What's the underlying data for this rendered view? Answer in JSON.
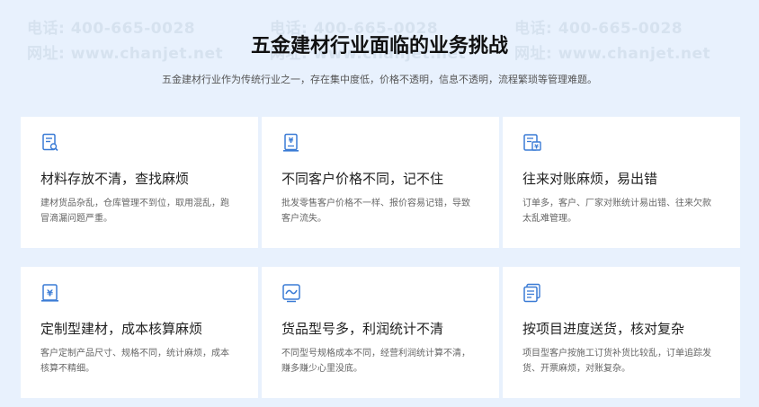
{
  "watermark": {
    "phone": "电话: 400-665-0028",
    "site": "网址: www.chanjet.net"
  },
  "section": {
    "title": "五金建材行业面临的业务挑战",
    "subtitle": "五金建材行业作为传统行业之一，存在集中度低，价格不透明，信息不透明，流程繁琐等管理难题。"
  },
  "cards": [
    {
      "icon": "document-search-icon",
      "title": "材料存放不清，查找麻烦",
      "desc": "建材货品杂乱，仓库管理不到位，取用混乱，跑冒滴漏问题严重。"
    },
    {
      "icon": "price-document-icon",
      "title": "不同客户价格不同，记不住",
      "desc": "批发零售客户价格不一样、报价容易记错，导致客户流失。"
    },
    {
      "icon": "reconciliation-icon",
      "title": "往来对账麻烦，易出错",
      "desc": "订单多，客户、厂家对账统计易出错、往来欠款太乱难管理。"
    },
    {
      "icon": "custom-price-icon",
      "title": "定制型建材，成本核算麻烦",
      "desc": "客户定制产品尺寸、规格不同，统计麻烦，成本核算不精细。"
    },
    {
      "icon": "profit-chart-icon",
      "title": "货品型号多，利润统计不清",
      "desc": "不同型号规格成本不同，经营利润统计算不清，赚多赚少心里没底。"
    },
    {
      "icon": "delivery-list-icon",
      "title": "按项目进度送货，核对复杂",
      "desc": "项目型客户按施工订货补货比较乱，订单追踪发货、开票麻烦，对账复杂。"
    }
  ],
  "colors": {
    "background": "#e8f1fd",
    "card": "#ffffff",
    "icon_blue": "#3a7bd5"
  }
}
